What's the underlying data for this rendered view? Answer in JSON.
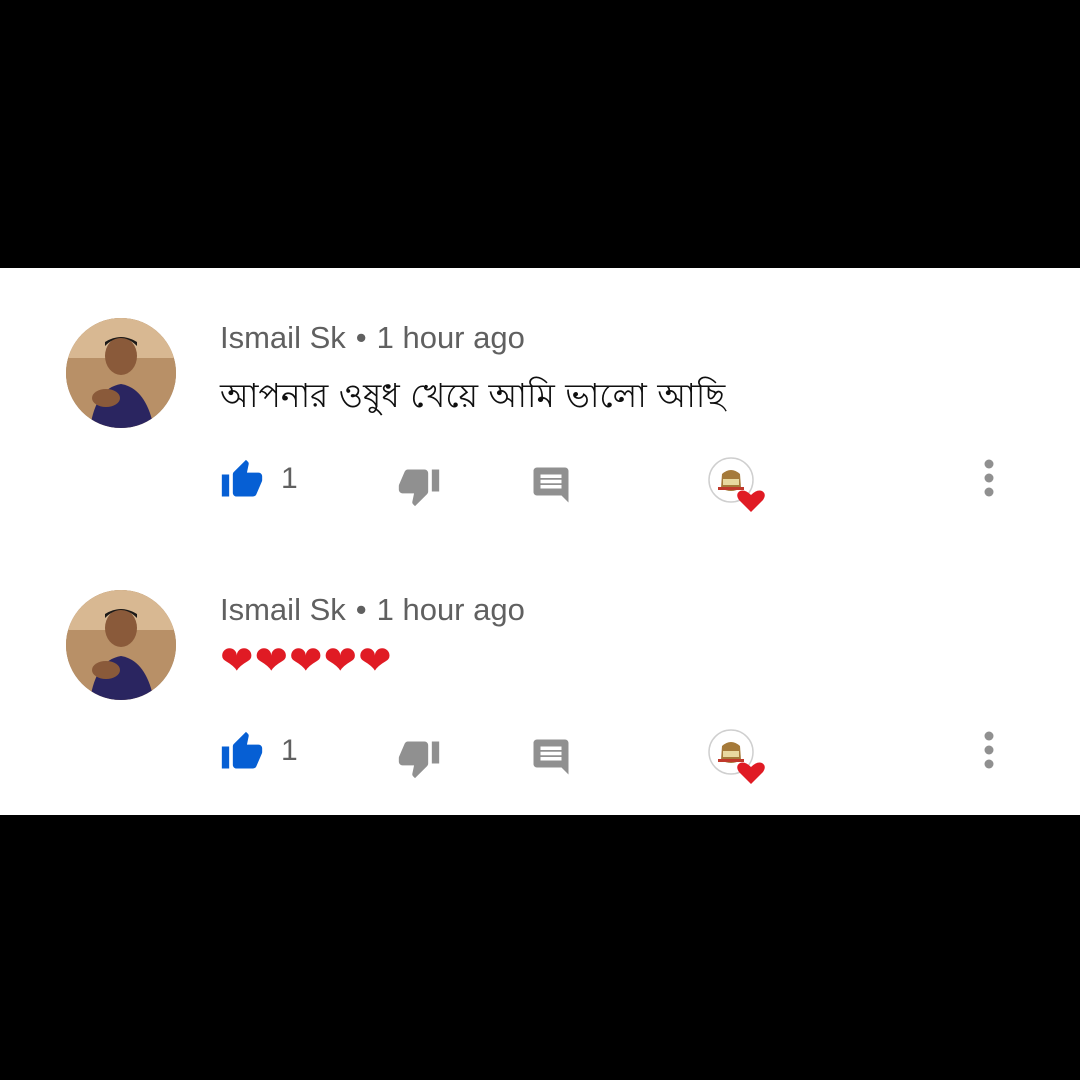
{
  "comments": [
    {
      "author": "Ismail Sk",
      "separator": "•",
      "time": "1 hour ago",
      "text": "আপনার ওষুধ খেয়ে আমি ভালো আছি",
      "like_count": "1",
      "liked": true
    },
    {
      "author": "Ismail Sk",
      "separator": "•",
      "time": "1 hour ago",
      "text": "❤❤❤❤❤",
      "like_count": "1",
      "liked": true
    }
  ],
  "colors": {
    "like_active": "#065fd4",
    "icon_gray": "#909090",
    "heart": "#e01b24",
    "meta_text": "#606060"
  },
  "icons": [
    "thumb-up-icon",
    "thumb-down-icon",
    "reply-icon",
    "creator-heart-icon",
    "more-vert-icon"
  ]
}
